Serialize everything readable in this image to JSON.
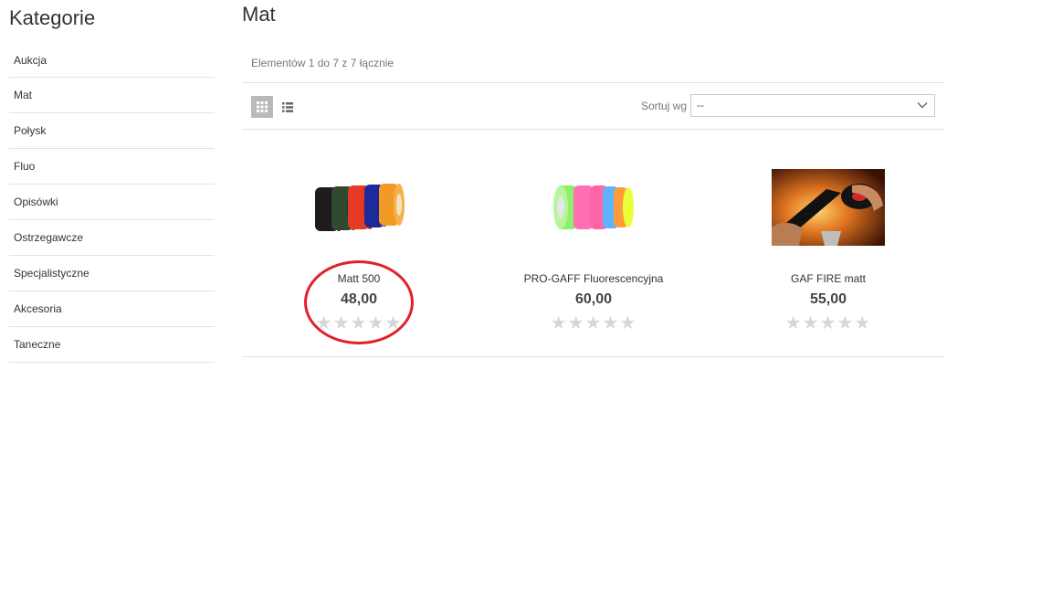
{
  "sidebar": {
    "title": "Kategorie",
    "items": [
      {
        "label": "Aukcja"
      },
      {
        "label": "Mat"
      },
      {
        "label": "Połysk"
      },
      {
        "label": "Fluo"
      },
      {
        "label": "Opisówki"
      },
      {
        "label": "Ostrzegawcze"
      },
      {
        "label": "Specjalistyczne"
      },
      {
        "label": "Akcesoria"
      },
      {
        "label": "Taneczne"
      }
    ]
  },
  "main": {
    "title": "Mat",
    "count_text": "Elementów 1 do 7 z 7 łącznie",
    "toolbar": {
      "grid_icon": "grid-view-icon",
      "list_icon": "list-view-icon",
      "sort_label": "Sortuj wg",
      "sort_value": "--"
    },
    "products": [
      {
        "name": "Matt 500",
        "price": "48,00",
        "stars": "★★★★★",
        "rating": 0
      },
      {
        "name": "PRO-GAFF Fluorescencyjna",
        "price": "60,00",
        "stars": "★★★★★",
        "rating": 0
      },
      {
        "name": "GAF FIRE matt",
        "price": "55,00",
        "stars": "★★★★★",
        "rating": 0
      }
    ]
  },
  "colors": {
    "annotation": "#e2202a",
    "star_empty": "#d6d6d6",
    "divider": "#e3e3e3"
  }
}
